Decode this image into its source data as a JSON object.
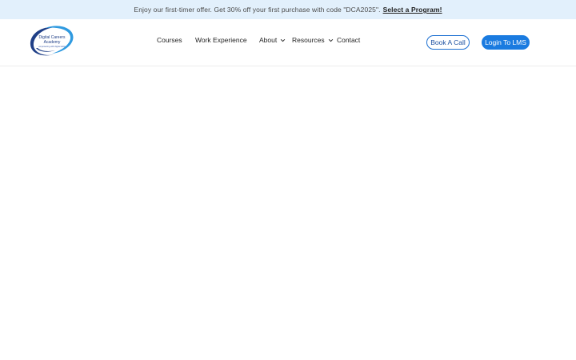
{
  "promo": {
    "text": "Enjoy our first-timer offer. Get 30% off your first purchase with code \"DCA2025\".",
    "link_label": "Select a Program!"
  },
  "logo": {
    "line1": "Digital Careers",
    "line2": "Academy",
    "tagline": "empowering with digital skills"
  },
  "nav": {
    "items": [
      {
        "label": "Courses",
        "has_dropdown": false
      },
      {
        "label": "Work Experience",
        "has_dropdown": false
      },
      {
        "label": "About",
        "has_dropdown": true
      },
      {
        "label": "Resources",
        "has_dropdown": true
      },
      {
        "label": "Contact",
        "has_dropdown": false
      }
    ]
  },
  "actions": {
    "book_call_label": "Book A Call",
    "login_label": "Login To LMS"
  },
  "colors": {
    "promo_bg": "#e2f0fc",
    "accent_blue": "#1a7be0",
    "logo_navy": "#1f3f87"
  }
}
